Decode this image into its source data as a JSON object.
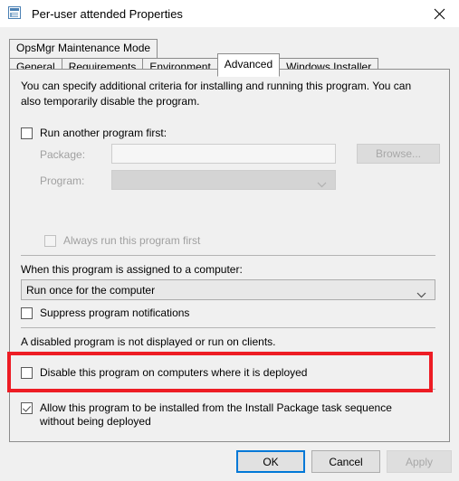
{
  "window": {
    "title": "Per-user attended Properties",
    "icon": "properties-window-icon",
    "close_label": "✕"
  },
  "tabs": {
    "top_row": [
      {
        "label": "OpsMgr Maintenance Mode",
        "selected": false
      }
    ],
    "bottom_row": [
      {
        "label": "General",
        "selected": false
      },
      {
        "label": "Requirements",
        "selected": false
      },
      {
        "label": "Environment",
        "selected": false
      },
      {
        "label": "Advanced",
        "selected": true
      },
      {
        "label": "Windows Installer",
        "selected": false
      }
    ]
  },
  "advanced": {
    "description": "You can specify additional criteria for installing and running this program. You can also temporarily disable the program.",
    "run_another_program": {
      "label": "Run another program first:",
      "checked": false
    },
    "package": {
      "label": "Package:",
      "value": "",
      "placeholder": ""
    },
    "program": {
      "label": "Program:",
      "value": ""
    },
    "browse_button": "Browse...",
    "always_run_first": {
      "label": "Always run this program first",
      "checked": false
    },
    "assigned_label": "When this program is assigned to a computer:",
    "assigned_value": "Run once for the computer",
    "assigned_options": [
      "Run once for the computer"
    ],
    "suppress_notifications": {
      "label": "Suppress program notifications",
      "checked": false
    },
    "disabled_note": "A disabled program is not displayed or run on clients.",
    "disable_program": {
      "label": "Disable this program on computers where it is deployed",
      "checked": false
    },
    "allow_task_sequence": {
      "label": "Allow this program to be installed from the Install Package task sequence without being deployed",
      "checked": true,
      "highlight_color": "#ed1c24"
    }
  },
  "footer": {
    "ok": "OK",
    "cancel": "Cancel",
    "apply": "Apply",
    "focus_color": "#0078d7"
  }
}
